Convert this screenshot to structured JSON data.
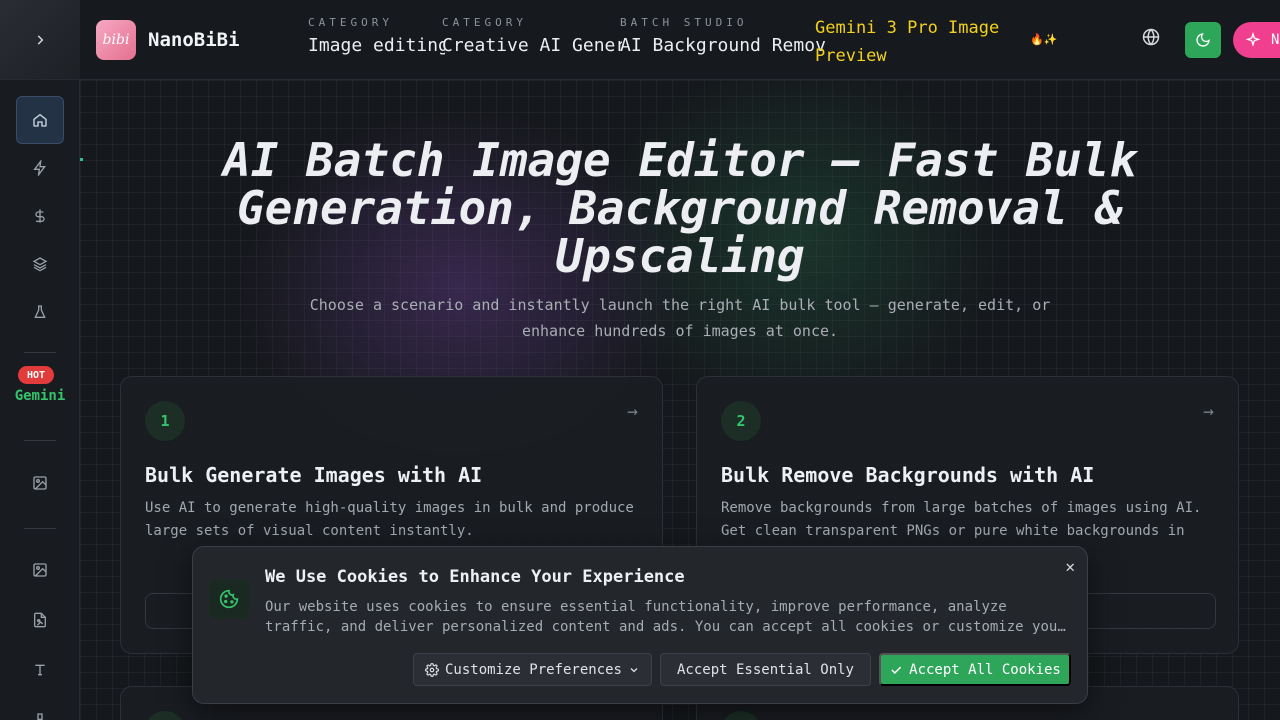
{
  "header": {
    "logo_text": "bibi",
    "brand": "NanoBiBi",
    "categories": [
      {
        "label": "CATEGORY",
        "title": "Image editing"
      },
      {
        "label": "CATEGORY",
        "title": "Creative AI Generation"
      },
      {
        "label": "BATCH STUDIO",
        "title": "AI Background Remover"
      }
    ],
    "gemini_link": "Gemini 3 Pro Image Preview",
    "magic_label": "N"
  },
  "sidebar": {
    "hot_badge": "HOT",
    "gemini_label": "Gemini"
  },
  "hero": {
    "title": "AI Batch Image Editor — Fast Bulk Generation, Background Removal & Upscaling",
    "subtitle": "Choose a scenario and instantly launch the right AI bulk tool — generate, edit, or enhance hundreds of images at once."
  },
  "cards": [
    {
      "number": "1",
      "title": "Bulk Generate Images with AI",
      "description": "Use AI to generate high-quality images in bulk and produce large sets of visual content instantly."
    },
    {
      "number": "2",
      "title": "Bulk Remove Backgrounds with AI",
      "description": "Remove backgrounds from large batches of images using AI. Get clean transparent PNGs or pure white backgrounds in"
    }
  ],
  "cookie": {
    "title": "We Use Cookies to Enhance Your Experience",
    "text": "Our website uses cookies to ensure essential functionality, improve performance, analyze traffic, and deliver personalized content and ads. You can accept all cookies or customize your preferences.",
    "customize_label": "Customize Preferences",
    "essential_label": "Accept Essential Only",
    "accept_label": "Accept All Cookies"
  },
  "colors": {
    "accent_green": "#2ea65a",
    "hot_red": "#e23b3b",
    "gemini_yellow": "#f2d21d",
    "magic_pink": "#ef3f8e"
  }
}
